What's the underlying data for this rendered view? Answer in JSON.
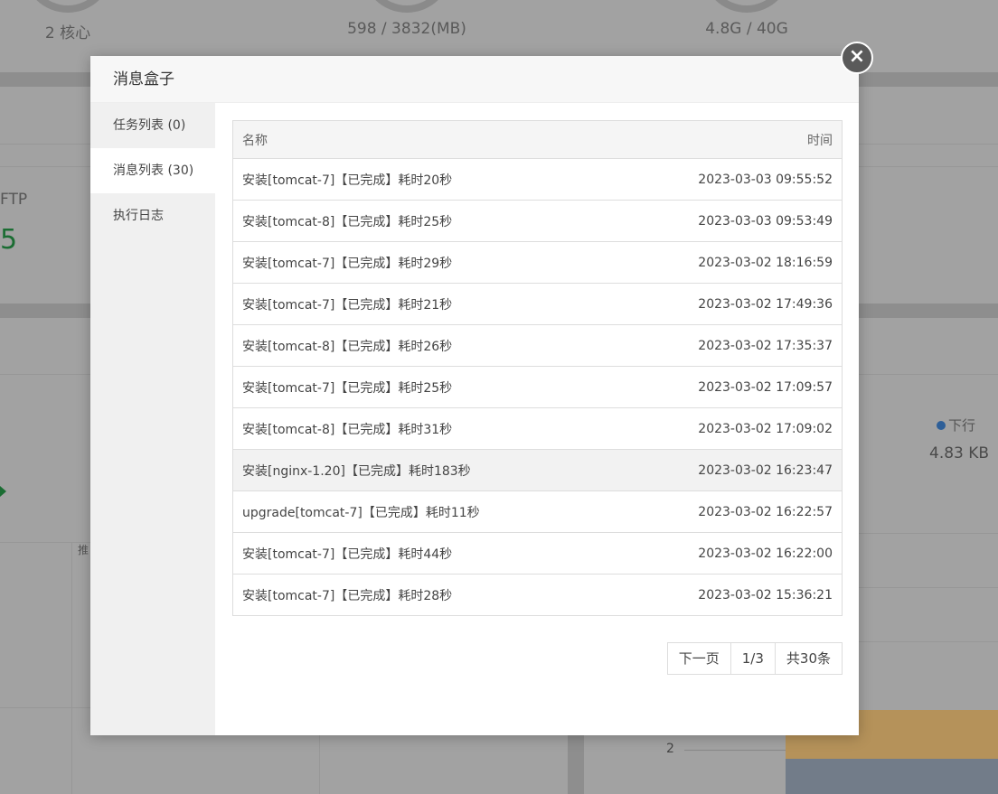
{
  "background": {
    "stats": [
      "2 核心",
      "598 / 3832(MB)",
      "4.8G / 40G"
    ],
    "ftp_label": "FTP",
    "ftp_value": "5",
    "legend_label": "下行",
    "legend_value": "4.83 KB",
    "small_label": "推",
    "axis_tick": "2"
  },
  "modal": {
    "title": "消息盒子",
    "close_symbol": "×",
    "sidebar": [
      {
        "label": "任务列表 (0)",
        "active": false
      },
      {
        "label": "消息列表 (30)",
        "active": true
      },
      {
        "label": "执行日志",
        "active": false
      }
    ],
    "table": {
      "headers": {
        "name": "名称",
        "time": "时间"
      },
      "rows": [
        {
          "name": "安装[tomcat-7]【已完成】耗时20秒",
          "time": "2023-03-03 09:55:52"
        },
        {
          "name": "安装[tomcat-8]【已完成】耗时25秒",
          "time": "2023-03-03 09:53:49"
        },
        {
          "name": "安装[tomcat-7]【已完成】耗时29秒",
          "time": "2023-03-02 18:16:59"
        },
        {
          "name": "安装[tomcat-7]【已完成】耗时21秒",
          "time": "2023-03-02 17:49:36"
        },
        {
          "name": "安装[tomcat-8]【已完成】耗时26秒",
          "time": "2023-03-02 17:35:37"
        },
        {
          "name": "安装[tomcat-7]【已完成】耗时25秒",
          "time": "2023-03-02 17:09:57"
        },
        {
          "name": "安装[tomcat-8]【已完成】耗时31秒",
          "time": "2023-03-02 17:09:02"
        },
        {
          "name": "安装[nginx-1.20]【已完成】耗时183秒",
          "time": "2023-03-02 16:23:47"
        },
        {
          "name": "upgrade[tomcat-7]【已完成】耗时11秒",
          "time": "2023-03-02 16:22:57"
        },
        {
          "name": "安装[tomcat-7]【已完成】耗时44秒",
          "time": "2023-03-02 16:22:00"
        },
        {
          "name": "安装[tomcat-7]【已完成】耗时28秒",
          "time": "2023-03-02 15:36:21"
        }
      ]
    },
    "pager": {
      "next": "下一页",
      "page": "1/3",
      "total": "共30条"
    }
  }
}
